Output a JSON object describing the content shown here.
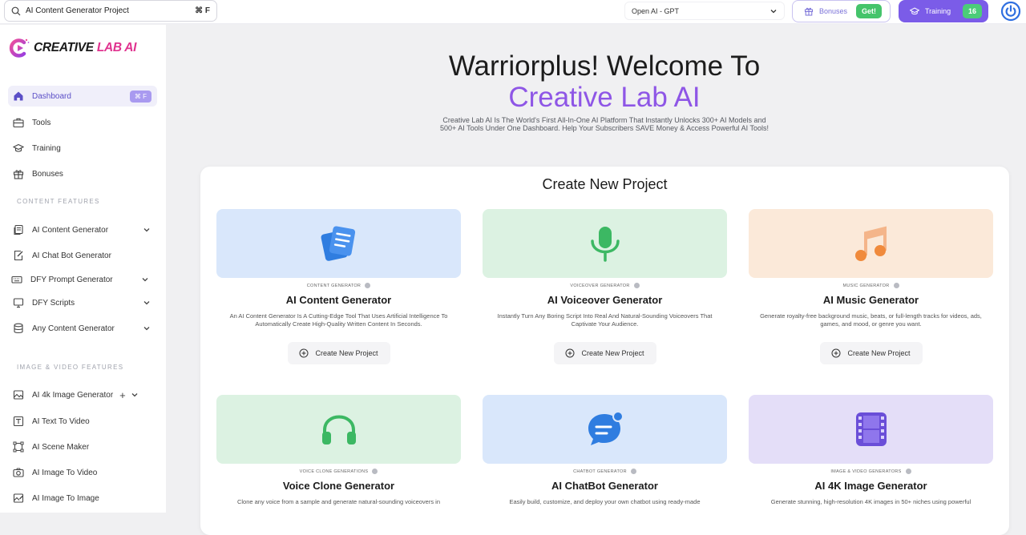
{
  "topbar": {
    "search_value": "AI Content Generator Project",
    "search_shortcut": "⌘ F",
    "model": "Open AI - GPT",
    "bonuses_label": "Bonuses",
    "bonuses_badge": "Get!",
    "training_label": "Training",
    "training_badge": "16"
  },
  "logo": {
    "part1": "CREATIVE ",
    "part2": "LAB AI"
  },
  "sidebar": {
    "main_items": [
      {
        "label": "Dashboard",
        "badge": "⌘ F"
      },
      {
        "label": "Tools"
      },
      {
        "label": "Training"
      },
      {
        "label": "Bonuses"
      }
    ],
    "content_section_label": "CONTENT FEATURES",
    "content_items": [
      {
        "label": "AI Content Generator"
      },
      {
        "label": "AI Chat Bot Generator"
      },
      {
        "label": "DFY Prompt Generator"
      },
      {
        "label": "DFY Scripts"
      },
      {
        "label": "Any Content Generator"
      }
    ],
    "media_section_label": "IMAGE & VIDEO FEATURES",
    "media_items": [
      {
        "label": "AI 4k Image Generator"
      },
      {
        "label": "AI Text To Video"
      },
      {
        "label": "AI Scene Maker"
      },
      {
        "label": "AI Image To Video"
      },
      {
        "label": "AI Image To Image"
      }
    ]
  },
  "hero": {
    "title": "Warriorplus! Welcome To",
    "subtitle": "Creative Lab AI",
    "description": "Creative Lab AI Is The World's First All-In-One AI Platform That Instantly Unlocks 300+ AI Models and 500+ AI Tools Under One Dashboard. Help Your Subscribers SAVE Money & Access Powerful AI Tools!"
  },
  "panel": {
    "title": "Create New Project",
    "create_label": "Create New Project",
    "cards": [
      {
        "category": "CONTENT GENERATOR",
        "name": "AI Content Generator",
        "desc": "An AI Content Generator Is A Cutting-Edge Tool That Uses Artificial Intelligence To Automatically Create High-Quality Written Content In Seconds.",
        "icon": "document-stack-icon",
        "bg": "#d9e7fb"
      },
      {
        "category": "VOICEOVER GENERATOR",
        "name": "AI Voiceover Generator",
        "desc": "Instantly Turn Any Boring Script Into Real And Natural-Sounding Voiceovers That Captivate Your Audience.",
        "icon": "microphone-icon",
        "bg": "#dcf2e2"
      },
      {
        "category": "Music GENERATOR",
        "name": "AI Music Generator",
        "desc": "Generate royalty-free background music, beats, or full-length tracks for videos, ads, games, and mood, or genre you want.",
        "icon": "music-note-icon",
        "bg": "#fbe9d9"
      },
      {
        "category": "VOICE CLONE GENERATIONS",
        "name": "Voice Clone Generator",
        "desc": "Clone any voice from a sample and generate natural-sounding voiceovers in",
        "icon": "headphones-icon",
        "bg": "#dcf2e2"
      },
      {
        "category": "CHATBOT GENERATOR",
        "name": "AI ChatBot Generator",
        "desc": "Easily build, customize, and deploy your own chatbot using ready-made",
        "icon": "chat-bubble-icon",
        "bg": "#d9e7fb"
      },
      {
        "category": "IMAGE & VIDEO GENERATORS",
        "name": "AI 4K Image Generator",
        "desc": "Generate stunning, high-resolution 4K images in 50+ niches using powerful",
        "icon": "film-strip-icon",
        "bg": "#e4def8"
      }
    ]
  }
}
